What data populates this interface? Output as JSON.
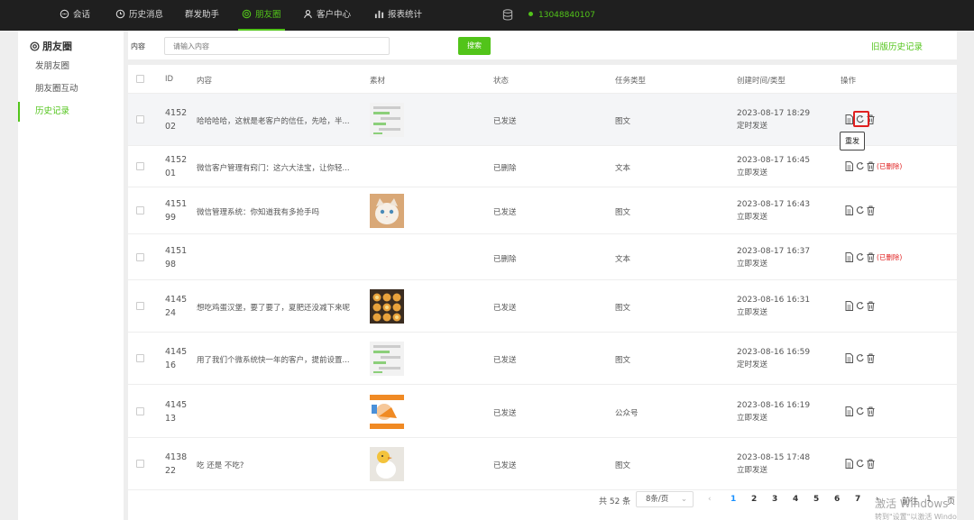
{
  "nav": {
    "items": [
      {
        "label": "会话",
        "icon": "chat-icon"
      },
      {
        "label": "历史消息",
        "icon": "clock-icon"
      },
      {
        "label": "群发助手",
        "icon": ""
      },
      {
        "label": "朋友圈",
        "icon": "moments-icon"
      },
      {
        "label": "客户中心",
        "icon": "user-icon"
      },
      {
        "label": "报表统计",
        "icon": "bar-chart-icon"
      }
    ],
    "active": "朋友圈",
    "phone": "13048840107"
  },
  "sidebar": {
    "title": "朋友圈",
    "items": [
      {
        "label": "发朋友圈"
      },
      {
        "label": "朋友圈互动"
      },
      {
        "label": "历史记录"
      }
    ],
    "active": "历史记录"
  },
  "search": {
    "label": "内容",
    "placeholder": "请输入内容",
    "button": "搜索",
    "old_link": "旧版历史记录"
  },
  "table": {
    "columns": [
      "ID",
      "内容",
      "素材",
      "状态",
      "任务类型",
      "创建时间/类型",
      "操作"
    ],
    "rows": [
      {
        "id_a": "4152",
        "id_b": "02",
        "content": "哈哈哈哈，这就是老客户的信任，先哈，半...",
        "material": "chat",
        "status": "已发送",
        "type": "图文",
        "time": "2023-08-17 18:29",
        "mode": "定时发送",
        "deleted": ""
      },
      {
        "id_a": "4152",
        "id_b": "01",
        "content": "微信客户管理有窍门：这六大法宝，让你轻...",
        "material": "",
        "status": "已删除",
        "type": "文本",
        "time": "2023-08-17 16:45",
        "mode": "立即发送",
        "deleted": "(已删除)"
      },
      {
        "id_a": "4151",
        "id_b": "99",
        "content": "微信管理系统：你知道我有多抢手吗",
        "material": "cat",
        "status": "已发送",
        "type": "图文",
        "time": "2023-08-17 16:43",
        "mode": "立即发送",
        "deleted": ""
      },
      {
        "id_a": "4151",
        "id_b": "98",
        "content": "",
        "material": "",
        "status": "已删除",
        "type": "文本",
        "time": "2023-08-17 16:37",
        "mode": "立即发送",
        "deleted": "(已删除)"
      },
      {
        "id_a": "4145",
        "id_b": "24",
        "content": "想吃鸡蛋汉堡，要了要了，夏肥还没减下来呢",
        "material": "food",
        "status": "已发送",
        "type": "图文",
        "time": "2023-08-16 16:31",
        "mode": "立即发送",
        "deleted": ""
      },
      {
        "id_a": "4145",
        "id_b": "16",
        "content": "用了我们个微系统快一年的客户，提前设置...",
        "material": "chat",
        "status": "已发送",
        "type": "图文",
        "time": "2023-08-16 16:59",
        "mode": "定时发送",
        "deleted": ""
      },
      {
        "id_a": "4145",
        "id_b": "13",
        "content": "",
        "material": "article",
        "status": "已发送",
        "type": "公众号",
        "time": "2023-08-16 16:19",
        "mode": "立即发送",
        "deleted": ""
      },
      {
        "id_a": "4138",
        "id_b": "22",
        "content": "吃 还是 不吃?",
        "material": "duck",
        "status": "已发送",
        "type": "图文",
        "time": "2023-08-15 17:48",
        "mode": "立即发送",
        "deleted": ""
      }
    ]
  },
  "tooltip": "重发",
  "pagination": {
    "total": "共 52 条",
    "page_size": "8条/页",
    "pages": [
      "1",
      "2",
      "3",
      "4",
      "5",
      "6",
      "7"
    ],
    "current": "1",
    "goto_label": "前往",
    "goto_value": "1",
    "goto_suffix": "页"
  },
  "watermark": {
    "line1": "激活 Windows",
    "line2": "转到\"设置\"以激活 Windo"
  },
  "colors": {
    "brand": "#52c41a",
    "danger": "#e02020",
    "link": "#1890ff",
    "topbar": "#1f1f1f"
  }
}
